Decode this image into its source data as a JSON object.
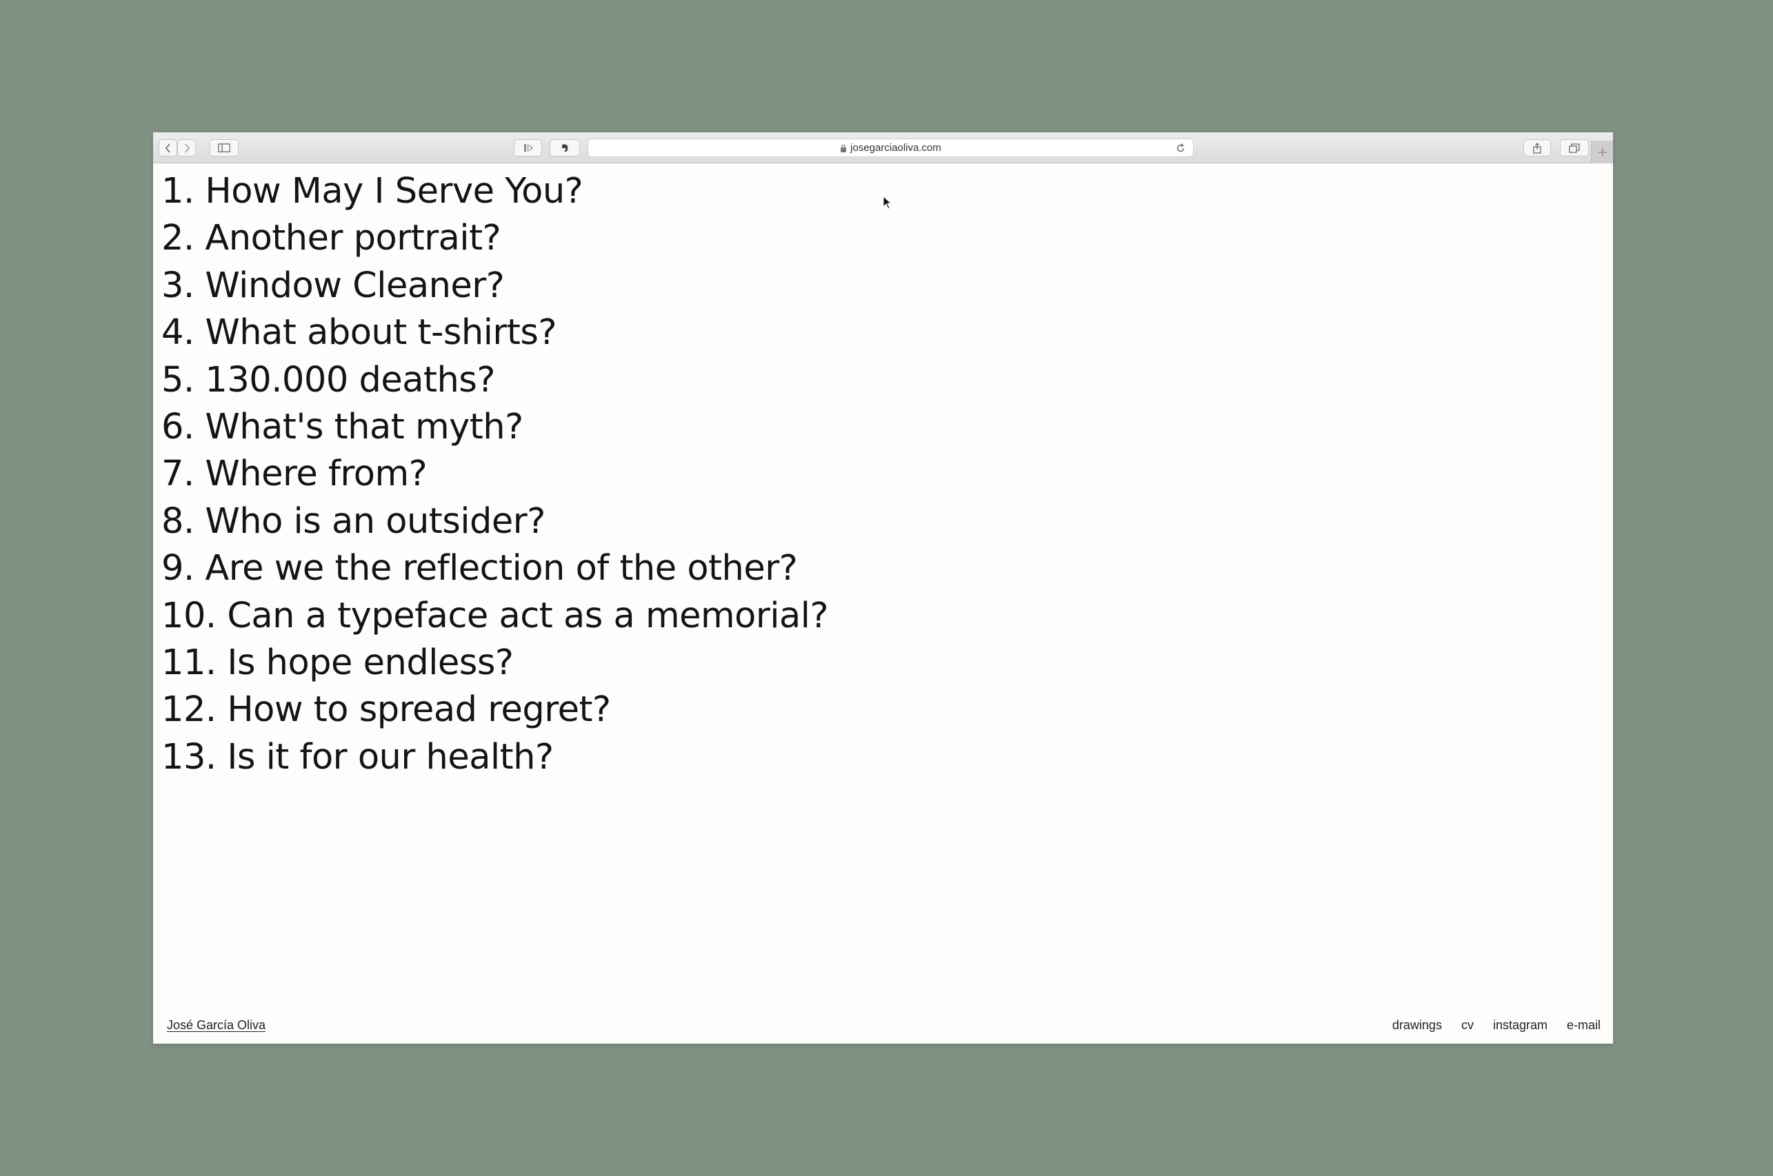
{
  "browser": {
    "url": "josegarciaoliva.com",
    "icons": [
      "back-icon",
      "forward-icon",
      "sidebar-icon",
      "reader-icon",
      "evernote-icon",
      "lock-icon",
      "reload-icon",
      "share-icon",
      "tabs-icon",
      "new-tab-icon"
    ]
  },
  "questions": [
    "1. How May I Serve You?",
    "2. Another portrait?",
    "3. Window Cleaner?",
    "4. What about t-shirts?",
    "5. 130.000 deaths?",
    "6. What's that myth?",
    "7. Where from?",
    "8. Who is an outsider?",
    "9. Are we the reflection of the other?",
    "10. Can a typeface act as a memorial?",
    "11. Is hope endless?",
    "12. How to spread regret?",
    "13. Is it for our health?"
  ],
  "footer": {
    "name": "José García Oliva",
    "links": [
      "drawings",
      "cv",
      "instagram",
      "e-mail"
    ]
  },
  "colors": {
    "backdrop": "#7f9183",
    "page": "#fdfdfb",
    "text": "#141414"
  }
}
